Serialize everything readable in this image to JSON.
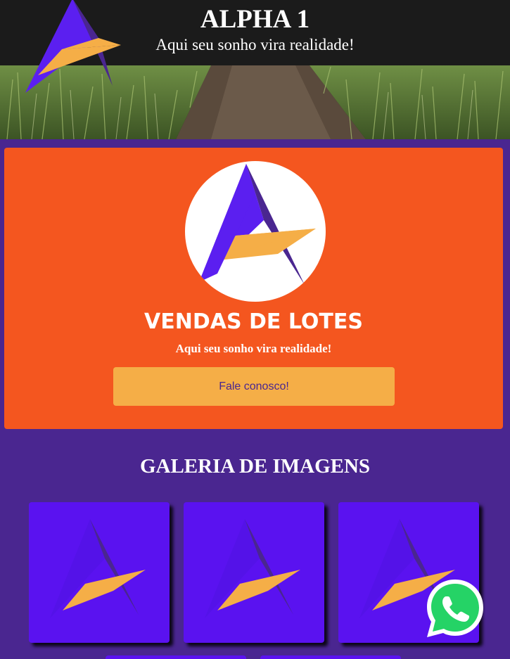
{
  "header": {
    "title": "ALPHA 1",
    "subtitle": "Aqui seu sonho vira realidade!"
  },
  "hero": {
    "title": "VENDAS DE LOTES",
    "subtitle": "Aqui seu sonho vira realidade!",
    "button_label": "Fale conosco!"
  },
  "gallery": {
    "title": "GALERIA DE IMAGENS"
  },
  "icons": {
    "logo": "alpha-logo-icon",
    "whatsapp": "whatsapp-icon"
  },
  "colors": {
    "page_background": "#4a2690",
    "header_background": "#1b1b1b",
    "hero_background": "#f4561f",
    "button_background": "#f5ae47",
    "thumbnail_background": "#5a12f0",
    "logo_purple": "#5b1ff0",
    "logo_dark_purple": "#4a2690",
    "logo_orange": "#f5ae47",
    "whatsapp_green": "#25d366"
  }
}
